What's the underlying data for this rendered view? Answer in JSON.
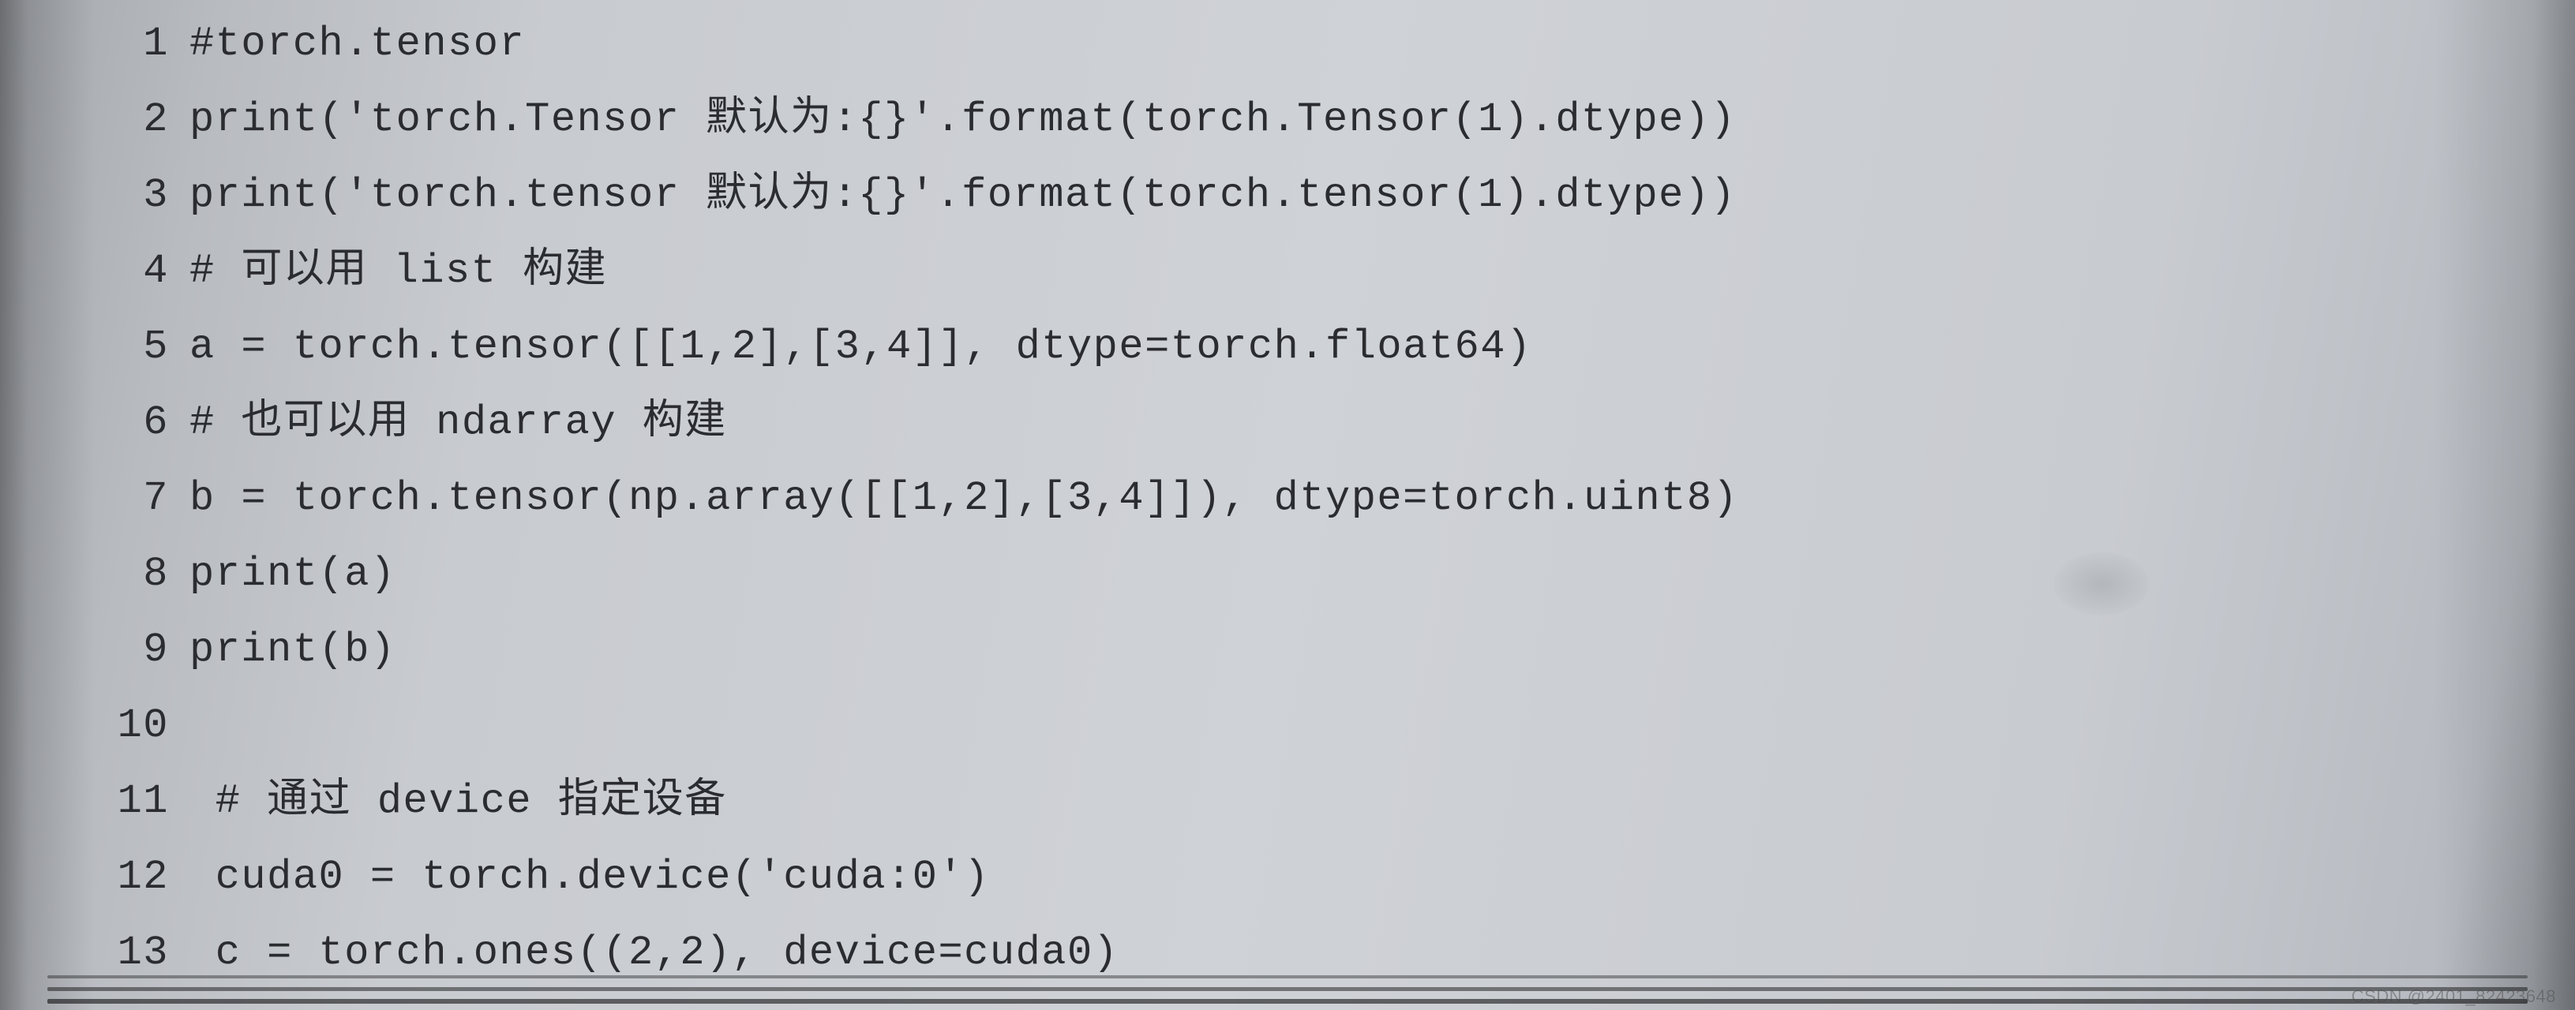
{
  "code": {
    "lines": [
      {
        "n": "1",
        "text": "#torch.tensor"
      },
      {
        "n": "2",
        "text": "print('torch.Tensor 默认为:{}'.format(torch.Tensor(1).dtype))"
      },
      {
        "n": "3",
        "text": "print('torch.tensor 默认为:{}'.format(torch.tensor(1).dtype))"
      },
      {
        "n": "4",
        "text": "# 可以用 list 构建"
      },
      {
        "n": "5",
        "text": "a = torch.tensor([[1,2],[3,4]], dtype=torch.float64)"
      },
      {
        "n": "6",
        "text": "# 也可以用 ndarray 构建"
      },
      {
        "n": "7",
        "text": "b = torch.tensor(np.array([[1,2],[3,4]]), dtype=torch.uint8)"
      },
      {
        "n": "8",
        "text": "print(a)"
      },
      {
        "n": "9",
        "text": "print(b)"
      },
      {
        "n": "10",
        "text": ""
      },
      {
        "n": "11",
        "text": " # 通过 device 指定设备"
      },
      {
        "n": "12",
        "text": " cuda0 = torch.device('cuda:0')"
      },
      {
        "n": "13",
        "text": " c = torch.ones((2,2), device=cuda0)"
      }
    ]
  },
  "watermark": "CSDN @2401_82423648"
}
